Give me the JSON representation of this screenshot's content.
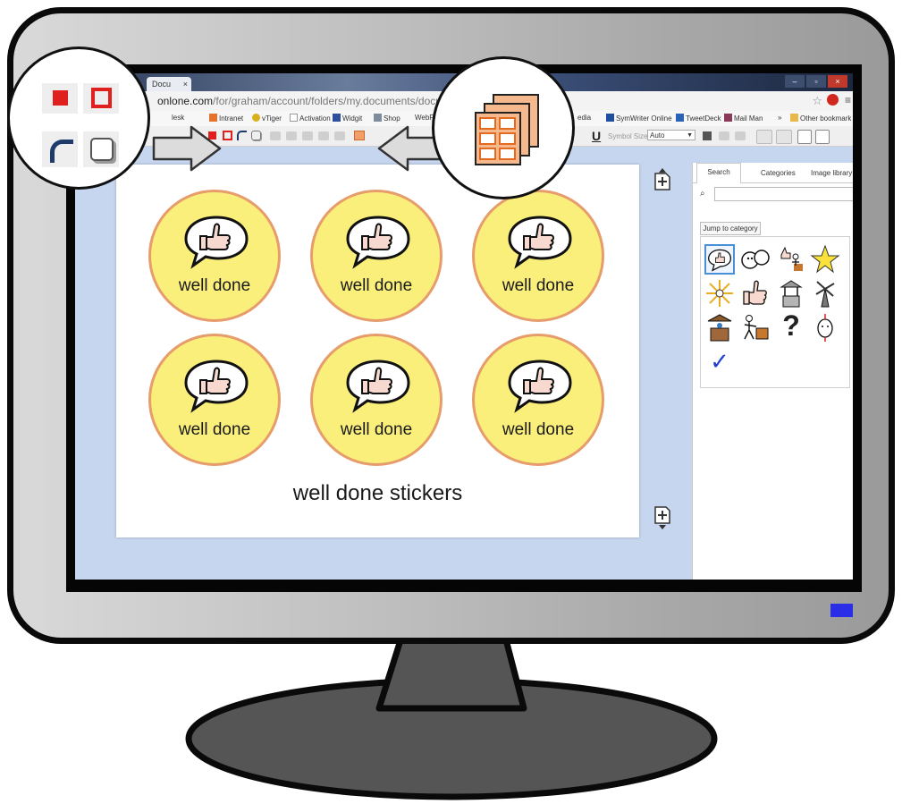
{
  "browser": {
    "tab_title": "Docu",
    "tab_close": "×",
    "window_buttons": [
      "–",
      "▫",
      "×"
    ],
    "url_host": "onlone.com",
    "url_path": "/for/graham/account/folders/my.documents/documents/ne",
    "menu_icon": "≡",
    "star_icon": "☆"
  },
  "bookmarks": [
    {
      "label": "lesk",
      "icon": "desk-icon"
    },
    {
      "label": "Intranet",
      "icon": "intranet-icon"
    },
    {
      "label": "vTiger",
      "icon": "vtiger-icon"
    },
    {
      "label": "Activation",
      "icon": "page-icon"
    },
    {
      "label": "Widgit",
      "icon": "widgit-icon"
    },
    {
      "label": "Shop",
      "icon": "shop-icon"
    },
    {
      "label": "WebF",
      "icon": "web-icon"
    },
    {
      "label": "edia",
      "icon": "media-icon"
    },
    {
      "label": "SymWriter Online",
      "icon": "symwriter-icon"
    },
    {
      "label": "TweetDeck",
      "icon": "tweetdeck-icon"
    },
    {
      "label": "Mail Man",
      "icon": "mail-icon"
    },
    {
      "label": "»",
      "icon": ""
    },
    {
      "label": "Other bookmark",
      "icon": "folder-icon"
    }
  ],
  "toolbar": {
    "underline": "U",
    "symbol_size_label": "Symbol Size",
    "symbol_size_value": "Auto",
    "caret": "▼"
  },
  "document": {
    "stickers": [
      {
        "caption": "well done"
      },
      {
        "caption": "well done"
      },
      {
        "caption": "well done"
      },
      {
        "caption": "well done"
      },
      {
        "caption": "well done"
      },
      {
        "caption": "well done"
      }
    ],
    "title": "well done stickers"
  },
  "panel": {
    "tabs": [
      "Search",
      "Categories",
      "Image library"
    ],
    "search_icon": "⌕",
    "jump_label": "Jump to category",
    "question_mark": "?",
    "check_mark": "✓"
  },
  "colors": {
    "sticker_fill": "#fbef7c",
    "sticker_border": "#e69c6b",
    "accent_red": "#e0201e",
    "border_blue": "#1f3b6b",
    "screen_bg": "#c7d6ef",
    "led_blue": "#2a2ee6"
  }
}
